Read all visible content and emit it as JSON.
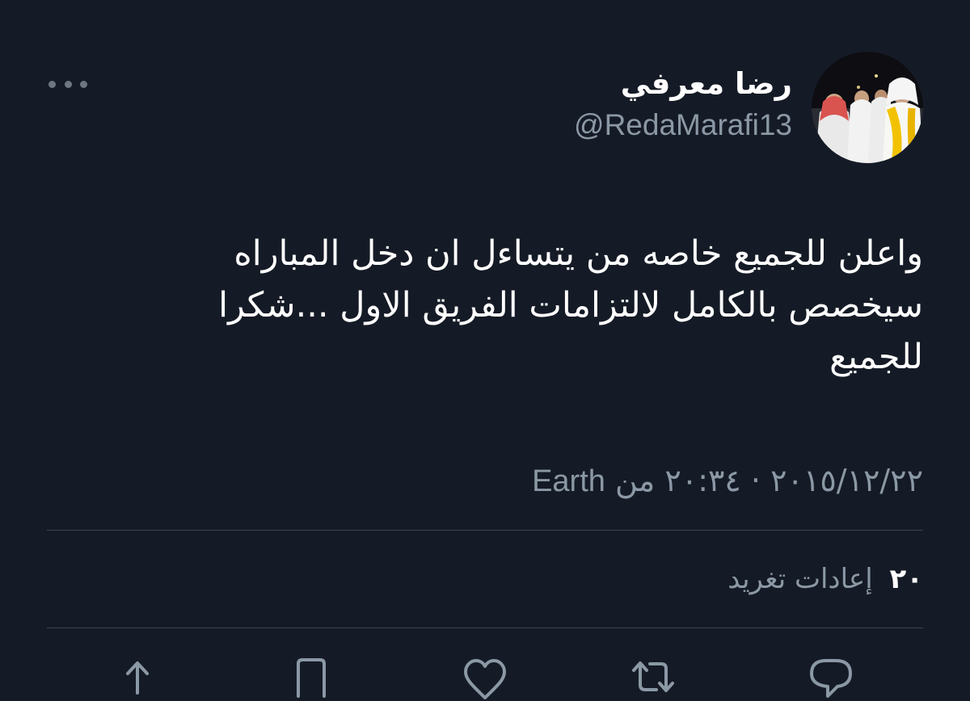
{
  "user": {
    "display_name": "رضا معرفي",
    "handle": "@RedaMarafi13",
    "avatar_alt": "avatar"
  },
  "tweet": {
    "text": "واعلن للجميع خاصه من يتساءل  ان دخل  المباراه\nسيخصص بالكامل لالتزامات الفريق الاول ...شكرا\nللجميع",
    "date": "٢٠١٥/١٢/٢٢",
    "separator": "·",
    "time": "٢٠:٣٤",
    "source_prefix": "من",
    "source": "Earth"
  },
  "stats": {
    "retweet_count": "٢٠",
    "retweet_label": "إعادات تغريد"
  },
  "actions": [
    {
      "name": "reply-icon"
    },
    {
      "name": "retweet-icon"
    },
    {
      "name": "like-icon"
    },
    {
      "name": "bookmark-icon"
    },
    {
      "name": "share-icon"
    }
  ],
  "colors": {
    "background": "#151b26",
    "primary_text": "#ffffff",
    "secondary_text": "#8b98a5",
    "divider": "#38444d"
  }
}
